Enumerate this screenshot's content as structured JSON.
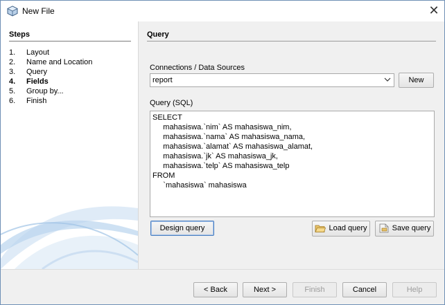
{
  "window": {
    "title": "New File"
  },
  "steps": {
    "title": "Steps",
    "items": [
      {
        "num": "1.",
        "label": "Layout"
      },
      {
        "num": "2.",
        "label": "Name and Location"
      },
      {
        "num": "3.",
        "label": "Query"
      },
      {
        "num": "4.",
        "label": "Fields"
      },
      {
        "num": "5.",
        "label": "Group by..."
      },
      {
        "num": "6.",
        "label": "Finish"
      }
    ]
  },
  "panel": {
    "title": "Query",
    "connections_label": "Connections / Data Sources",
    "connection_value": "report",
    "new_button": "New",
    "query_label": "Query (SQL)",
    "sql_lines": [
      "SELECT",
      "     mahasiswa.`nim` AS mahasiswa_nim,",
      "     mahasiswa.`nama` AS mahasiswa_nama,",
      "     mahasiswa.`alamat` AS mahasiswa_alamat,",
      "     mahasiswa.`jk` AS mahasiswa_jk,",
      "     mahasiswa.`telp` AS mahasiswa_telp",
      "FROM",
      "     `mahasiswa` mahasiswa"
    ],
    "design_query_button": "Design query",
    "load_query_button": "Load query",
    "save_query_button": "Save query"
  },
  "footer": {
    "back_button": "< Back",
    "next_button": "Next >",
    "finish_button": "Finish",
    "cancel_button": "Cancel",
    "help_button": "Help"
  },
  "colors": {
    "accent_focus": "#4a7ec0",
    "swoosh": "#9fc3e6"
  }
}
